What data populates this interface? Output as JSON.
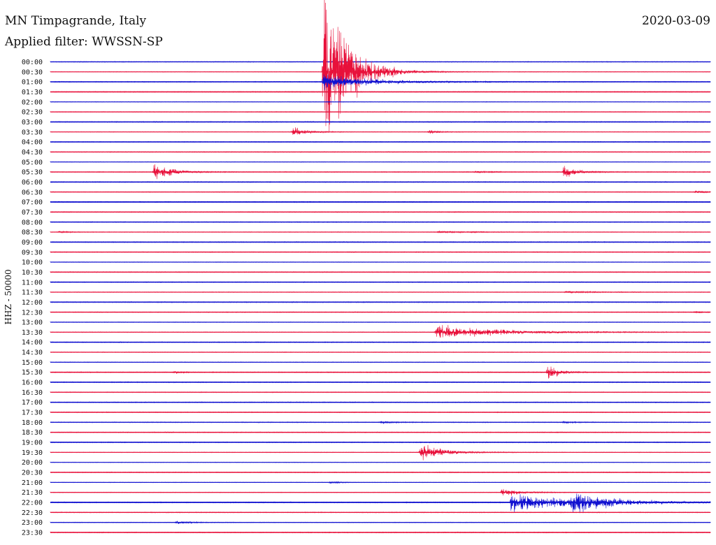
{
  "header": {
    "station": "MN Timpagrande, Italy",
    "date": "2020-03-09",
    "filter": "Applied filter: WWSSN-SP"
  },
  "chart_data": {
    "type": "line",
    "title": "MN Timpagrande, Italy",
    "subtitle": "Applied filter: WWSSN-SP",
    "date": "2020-03-09",
    "ylabel": "HHZ - 50000",
    "xlabel": "",
    "row_interval_minutes": 30,
    "colors": {
      "even_rows": "#1010d0",
      "odd_rows": "#e8103a"
    },
    "rows": [
      {
        "label": "00:00",
        "noise": 0.7
      },
      {
        "label": "00:30",
        "noise": 0.4
      },
      {
        "label": "01:00",
        "noise": 1.0
      },
      {
        "label": "01:30",
        "noise": 0.9
      },
      {
        "label": "02:00",
        "noise": 0.4
      },
      {
        "label": "02:30",
        "noise": 0.6
      },
      {
        "label": "03:00",
        "noise": 1.0
      },
      {
        "label": "03:30",
        "noise": 0.4
      },
      {
        "label": "04:00",
        "noise": 0.9
      },
      {
        "label": "04:30",
        "noise": 0.7
      },
      {
        "label": "05:00",
        "noise": 0.4
      },
      {
        "label": "05:30",
        "noise": 0.8
      },
      {
        "label": "06:00",
        "noise": 1.0
      },
      {
        "label": "06:30",
        "noise": 0.6
      },
      {
        "label": "07:00",
        "noise": 1.2
      },
      {
        "label": "07:30",
        "noise": 0.8
      },
      {
        "label": "08:00",
        "noise": 0.9
      },
      {
        "label": "08:30",
        "noise": 0.5
      },
      {
        "label": "09:00",
        "noise": 1.0
      },
      {
        "label": "09:30",
        "noise": 0.8
      },
      {
        "label": "10:00",
        "noise": 0.4
      },
      {
        "label": "10:30",
        "noise": 0.8
      },
      {
        "label": "11:00",
        "noise": 0.9
      },
      {
        "label": "11:30",
        "noise": 0.5
      },
      {
        "label": "12:00",
        "noise": 1.0
      },
      {
        "label": "12:30",
        "noise": 0.8
      },
      {
        "label": "13:00",
        "noise": 0.5
      },
      {
        "label": "13:30",
        "noise": 0.6
      },
      {
        "label": "14:00",
        "noise": 1.0
      },
      {
        "label": "14:30",
        "noise": 0.6
      },
      {
        "label": "15:00",
        "noise": 0.6
      },
      {
        "label": "15:30",
        "noise": 1.0
      },
      {
        "label": "16:00",
        "noise": 1.0
      },
      {
        "label": "16:30",
        "noise": 0.7
      },
      {
        "label": "17:00",
        "noise": 1.0
      },
      {
        "label": "17:30",
        "noise": 0.8
      },
      {
        "label": "18:00",
        "noise": 0.8
      },
      {
        "label": "18:30",
        "noise": 0.9
      },
      {
        "label": "19:00",
        "noise": 1.0
      },
      {
        "label": "19:30",
        "noise": 0.5
      },
      {
        "label": "20:00",
        "noise": 0.4
      },
      {
        "label": "20:30",
        "noise": 0.9
      },
      {
        "label": "21:00",
        "noise": 0.4
      },
      {
        "label": "21:30",
        "noise": 0.5
      },
      {
        "label": "22:00",
        "noise": 1.2
      },
      {
        "label": "22:30",
        "noise": 0.8
      },
      {
        "label": "23:00",
        "noise": 0.5
      },
      {
        "label": "23:30",
        "noise": 1.0
      }
    ],
    "events": [
      {
        "row": 1,
        "minute": 12.4,
        "amplitude": 200,
        "duration": 1.0
      },
      {
        "row": 2,
        "minute": 12.4,
        "amplitude": 16,
        "duration": 2.0
      },
      {
        "row": 7,
        "minute": 11.0,
        "amplitude": 10,
        "duration": 0.6
      },
      {
        "row": 7,
        "minute": 17.2,
        "amplitude": 5,
        "duration": 0.4
      },
      {
        "row": 11,
        "minute": 4.7,
        "amplitude": 15,
        "duration": 0.8
      },
      {
        "row": 11,
        "minute": 23.3,
        "amplitude": 12,
        "duration": 0.6
      },
      {
        "row": 11,
        "minute": 19.3,
        "amplitude": 2,
        "duration": 0.6
      },
      {
        "row": 13,
        "minute": 29.3,
        "amplitude": 4,
        "duration": 0.3
      },
      {
        "row": 17,
        "minute": 17.6,
        "amplitude": 2,
        "duration": 1.0
      },
      {
        "row": 17,
        "minute": 19.1,
        "amplitude": 1.5,
        "duration": 0.3
      },
      {
        "row": 17,
        "minute": 0.4,
        "amplitude": 2,
        "duration": 0.4
      },
      {
        "row": 23,
        "minute": 23.4,
        "amplitude": 2,
        "duration": 1.2
      },
      {
        "row": 25,
        "minute": 29.3,
        "amplitude": 2.5,
        "duration": 0.3
      },
      {
        "row": 27,
        "minute": 17.5,
        "amplitude": 15,
        "duration": 2.5
      },
      {
        "row": 31,
        "minute": 22.6,
        "amplitude": 14,
        "duration": 0.5
      },
      {
        "row": 31,
        "minute": 5.6,
        "amplitude": 3,
        "duration": 0.3
      },
      {
        "row": 39,
        "minute": 16.8,
        "amplitude": 16,
        "duration": 1.0
      },
      {
        "row": 42,
        "minute": 12.7,
        "amplitude": 3,
        "duration": 0.3
      },
      {
        "row": 43,
        "minute": 20.5,
        "amplitude": 10,
        "duration": 0.7
      },
      {
        "row": 44,
        "minute": 20.9,
        "amplitude": 18,
        "duration": 2.8
      },
      {
        "row": 44,
        "minute": 23.7,
        "amplitude": 16,
        "duration": 1.5
      },
      {
        "row": 46,
        "minute": 5.7,
        "amplitude": 3,
        "duration": 0.6
      },
      {
        "row": 36,
        "minute": 15.0,
        "amplitude": 3,
        "duration": 0.4
      },
      {
        "row": 36,
        "minute": 23.3,
        "amplitude": 2,
        "duration": 0.5
      }
    ]
  }
}
